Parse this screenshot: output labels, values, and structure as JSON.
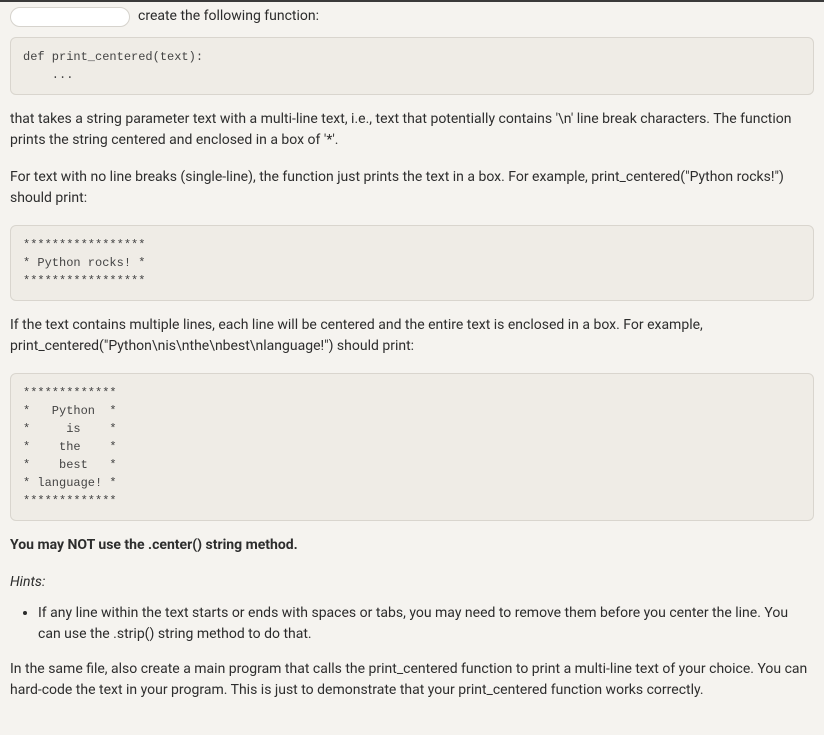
{
  "intro": {
    "input_value": "",
    "input_placeholder": "",
    "tail_text": "create the following function:"
  },
  "code1": "def print_centered(text):\n    ...",
  "para1": "that takes a string parameter text with a multi-line text, i.e., text that potentially contains '\\n' line break characters. The function prints the string centered and enclosed in a box of '*'.",
  "para2": "For text with no line breaks (single-line), the function just prints the text in a box. For example, print_centered(\"Python rocks!\") should print:",
  "code2": "*****************\n* Python rocks! *\n*****************",
  "para3": "If the text contains multiple lines, each line will be centered and the entire text is enclosed in a box. For example, print_centered(\"Python\\nis\\nthe\\nbest\\nlanguage!\") should print:",
  "code3": "*************\n*   Python  *\n*     is    *\n*    the    *\n*    best   *\n* language! *\n*************",
  "restriction": "You may NOT use the .center() string method.",
  "hints_label": "Hints:",
  "hints": [
    "If any line within the text starts or ends with spaces or tabs, you may need to remove them before you center the line. You can use the .strip() string method to do that."
  ],
  "closing": "In the same file, also create a main program that calls the print_centered function to print a multi-line text of your choice. You can hard-code the text in your program. This is just to demonstrate that your print_centered function works correctly."
}
